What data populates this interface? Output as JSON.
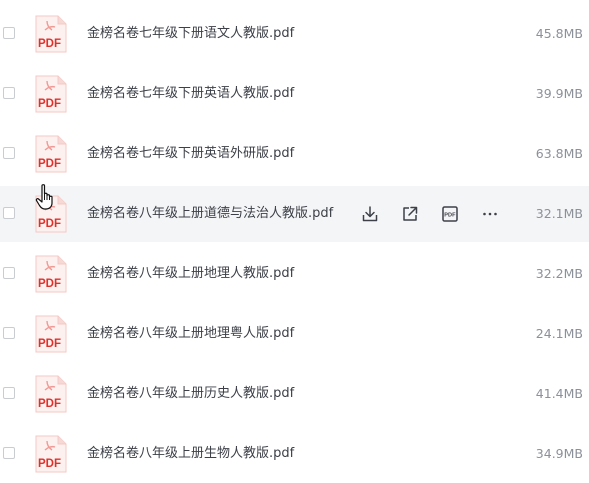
{
  "files": [
    {
      "name": "金榜名卷七年级下册语文人教版.pdf",
      "size": "45.8MB",
      "icon_label": "PDF"
    },
    {
      "name": "金榜名卷七年级下册英语人教版.pdf",
      "size": "39.9MB",
      "icon_label": "PDF"
    },
    {
      "name": "金榜名卷七年级下册英语外研版.pdf",
      "size": "63.8MB",
      "icon_label": "PDF"
    },
    {
      "name": "金榜名卷八年级上册道德与法治人教版.pdf",
      "size": "32.1MB",
      "icon_label": "PDF"
    },
    {
      "name": "金榜名卷八年级上册地理人教版.pdf",
      "size": "32.2MB",
      "icon_label": "PDF"
    },
    {
      "name": "金榜名卷八年级上册地理粤人版.pdf",
      "size": "24.1MB",
      "icon_label": "PDF"
    },
    {
      "name": "金榜名卷八年级上册历史人教版.pdf",
      "size": "41.4MB",
      "icon_label": "PDF"
    },
    {
      "name": "金榜名卷八年级上册生物人教版.pdf",
      "size": "34.9MB",
      "icon_label": "PDF"
    }
  ],
  "hovered_row_index": 3,
  "hover_actions": [
    {
      "icon": "download-icon"
    },
    {
      "icon": "share-icon"
    },
    {
      "icon": "pdf-convert-icon",
      "label": "PDF"
    },
    {
      "icon": "more-icon"
    }
  ],
  "colors": {
    "pdf_red": "#e0302a",
    "row_hover_bg": "#f4f5f7",
    "name_text": "#3d4048",
    "size_text": "#8c9099",
    "action_icon": "#3d4048"
  }
}
